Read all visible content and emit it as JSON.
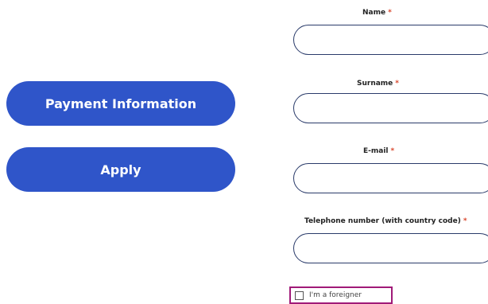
{
  "actions": {
    "payment_label": "Payment Information",
    "apply_label": "Apply"
  },
  "form": {
    "required_marker": "*",
    "name": {
      "label": "Name",
      "value": ""
    },
    "surname": {
      "label": "Surname",
      "value": ""
    },
    "email": {
      "label": "E-mail",
      "value": ""
    },
    "phone": {
      "label": "Telephone number (with country code)",
      "value": ""
    },
    "foreigner": {
      "label": "I'm a foreigner",
      "checked": false
    }
  },
  "colors": {
    "button_bg": "#2f55c9",
    "required_marker": "#d9452b",
    "input_border": "#2a3b6a",
    "highlight_border": "#a01a78"
  }
}
